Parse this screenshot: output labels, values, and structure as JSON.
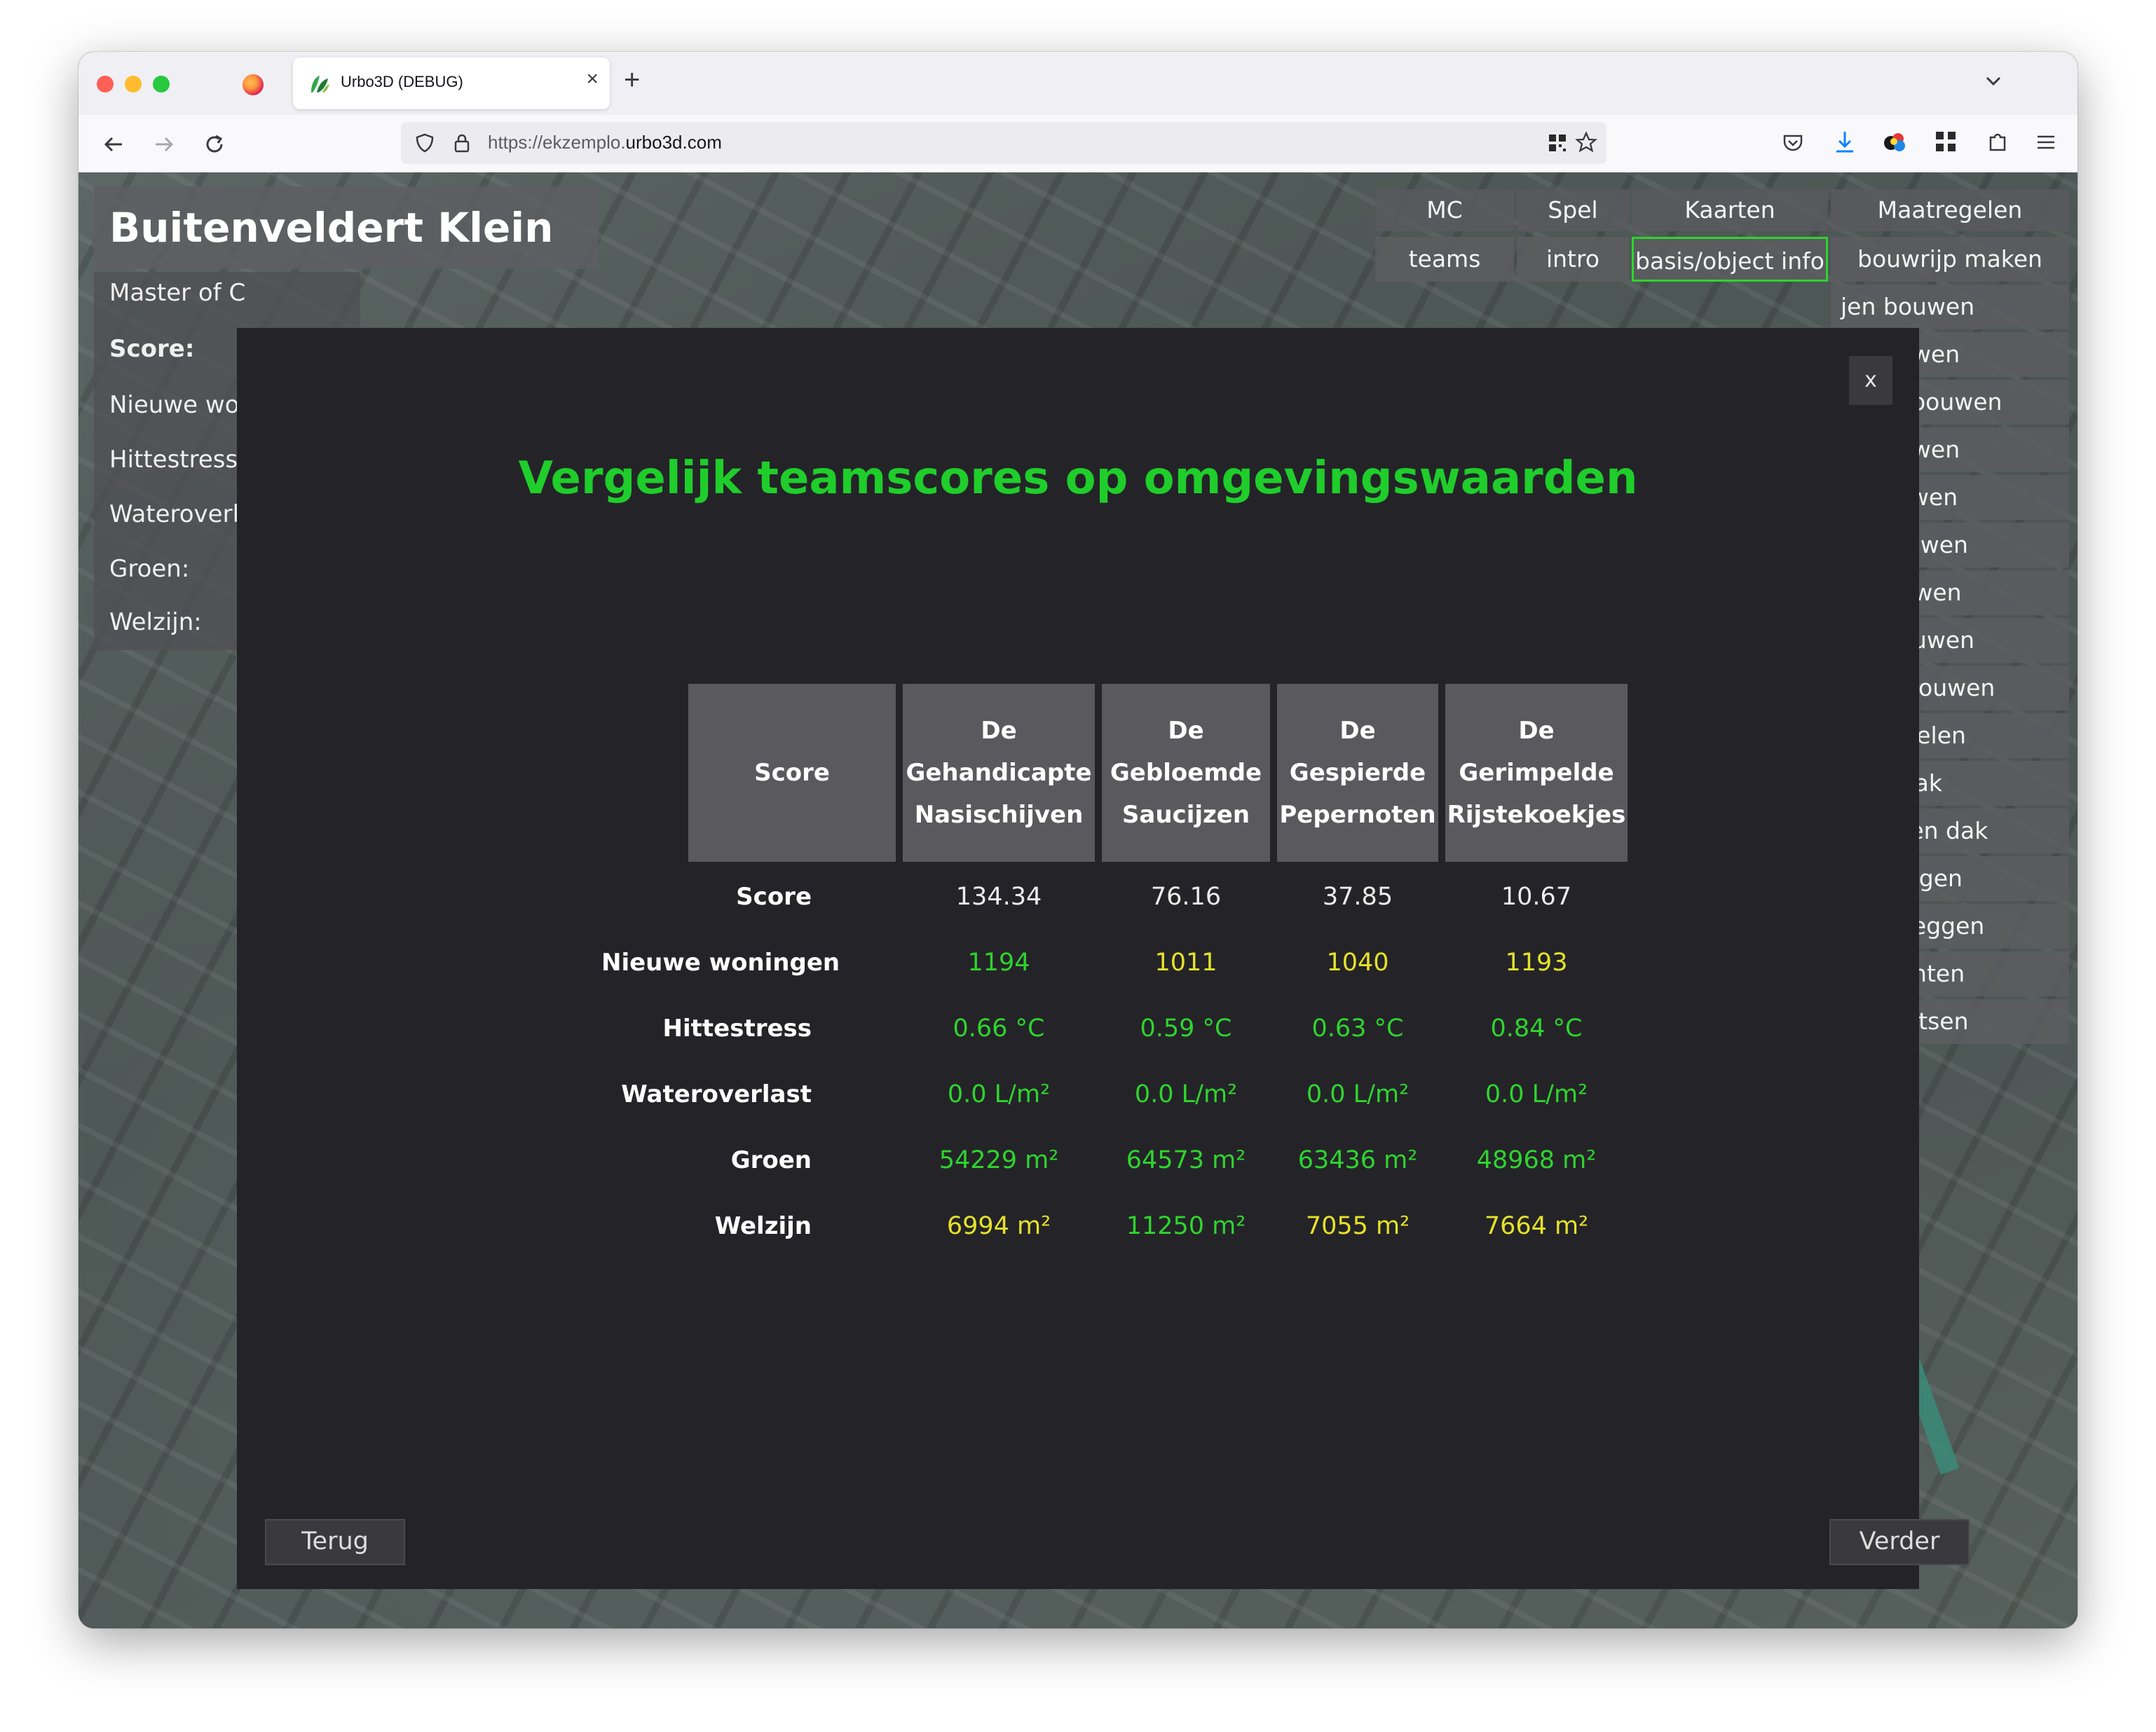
{
  "browser": {
    "tab_title": "Urbo3D (DEBUG)",
    "tab_close": "×",
    "new_tab": "+",
    "url_prefix": "https://ekzemplo.",
    "url_host": "urbo3d.com"
  },
  "app": {
    "city_title": "Buitenveldert Klein",
    "left_panel": {
      "master": "Master of C",
      "score_label": "Score:",
      "items": [
        "Nieuwe won",
        "Hittestress:",
        "Wateroverla",
        "Groen:",
        "Welzijn:"
      ]
    },
    "menu": {
      "headers": [
        "MC",
        "Spel",
        "Kaarten",
        "Maatregelen"
      ],
      "row1": [
        "teams",
        "intro",
        "basis/object info",
        "bouwrijp maken"
      ],
      "measures": [
        "jen bouwen",
        "ol bouwen",
        "aktijk bouwen",
        "al bouwen",
        "ls bouwen",
        "en bouwen",
        "af bouwen",
        "hal bouwen",
        "trum bouwen",
        "onttegelen",
        "roen dak",
        "er groen dak",
        "aanleggen",
        "n aanleggen",
        "en planten",
        "in plaatsen"
      ]
    }
  },
  "modal": {
    "close_label": "x",
    "title": "Vergelijk teamscores op omgevingswaarden",
    "header_first": "Score",
    "teams": [
      {
        "name": "De Gehandicapte Nasischijven"
      },
      {
        "name": "De Gebloemde Saucijzen"
      },
      {
        "name": "De Gespierde Pepernoten"
      },
      {
        "name": "De Gerimpelde Rijstekoekjes"
      }
    ],
    "rows": [
      {
        "label": "Score",
        "values": [
          "134.34",
          "76.16",
          "37.85",
          "10.67"
        ],
        "colors": [
          "w",
          "w",
          "w",
          "w"
        ]
      },
      {
        "label": "Nieuwe woningen",
        "values": [
          "1194",
          "1011",
          "1040",
          "1193"
        ],
        "colors": [
          "g",
          "y",
          "y",
          "y"
        ]
      },
      {
        "label": "Hittestress",
        "values": [
          "0.66 °C",
          "0.59 °C",
          "0.63 °C",
          "0.84 °C"
        ],
        "colors": [
          "g",
          "g",
          "g",
          "g"
        ]
      },
      {
        "label": "Wateroverlast",
        "values": [
          "0.0 L/m²",
          "0.0 L/m²",
          "0.0 L/m²",
          "0.0 L/m²"
        ],
        "colors": [
          "g",
          "g",
          "g",
          "g"
        ]
      },
      {
        "label": "Groen",
        "values": [
          "54229 m²",
          "64573 m²",
          "63436 m²",
          "48968 m²"
        ],
        "colors": [
          "g",
          "g",
          "g",
          "g"
        ]
      },
      {
        "label": "Welzijn",
        "values": [
          "6994 m²",
          "11250 m²",
          "7055 m²",
          "7664 m²"
        ],
        "colors": [
          "y",
          "g",
          "y",
          "y"
        ]
      }
    ],
    "back_label": "Terug",
    "next_label": "Verder"
  },
  "colors": {
    "title_green": "#1fcd2b",
    "good_green": "#2fd42f",
    "warn_yellow": "#e6e22a",
    "modal_bg": "#242428"
  }
}
